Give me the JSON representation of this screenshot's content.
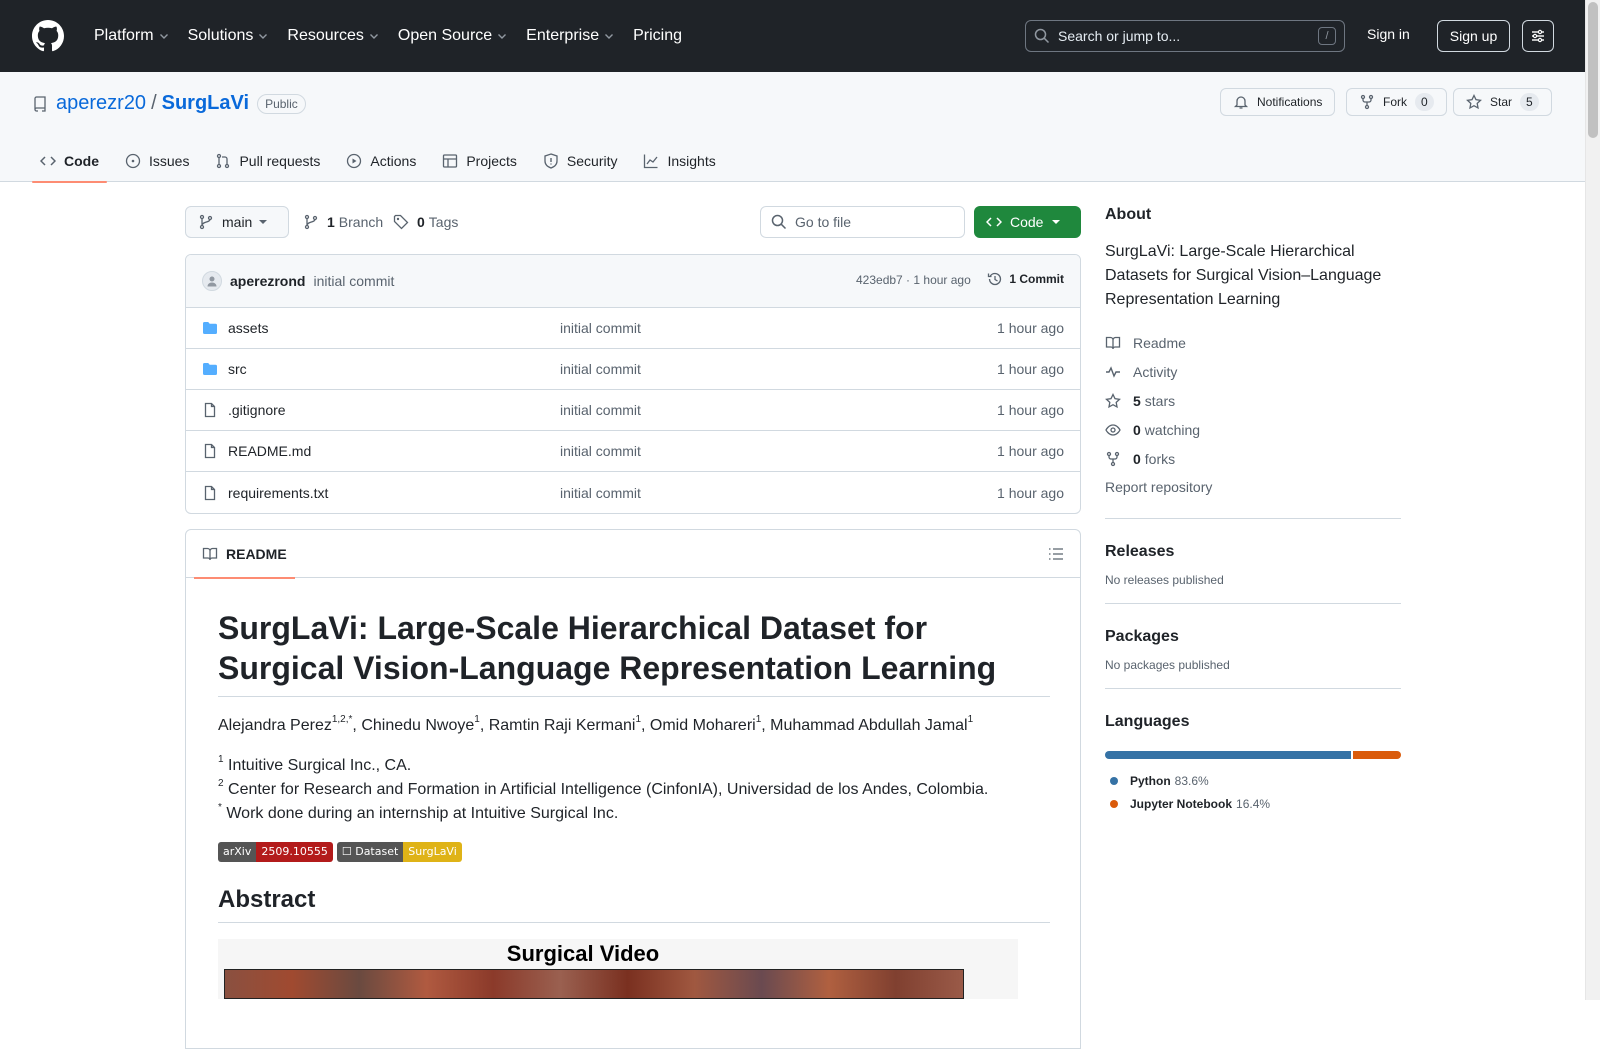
{
  "header": {
    "nav": [
      "Platform",
      "Solutions",
      "Resources",
      "Open Source",
      "Enterprise",
      "Pricing"
    ],
    "search_placeholder": "Search or jump to...",
    "search_key": "/",
    "signin": "Sign in",
    "signup": "Sign up"
  },
  "repo": {
    "owner": "aperezr20",
    "separator": "/",
    "name": "SurgLaVi",
    "visibility": "Public",
    "notifications": "Notifications",
    "fork_label": "Fork",
    "fork_count": "0",
    "star_label": "Star",
    "star_count": "5",
    "tabs": [
      "Code",
      "Issues",
      "Pull requests",
      "Actions",
      "Projects",
      "Security",
      "Insights"
    ]
  },
  "toolbar": {
    "branch": "main",
    "branch_count": "1",
    "branch_label": "Branch",
    "tag_count": "0",
    "tag_label": "Tags",
    "gofile_placeholder": "Go to file",
    "code_label": "Code"
  },
  "commit": {
    "author": "aperezrond",
    "message": "initial commit",
    "hash_time": "423edb7 · 1 hour ago",
    "count": "1 Commit"
  },
  "files": [
    {
      "name": "assets",
      "type": "folder",
      "message": "initial commit",
      "age": "1 hour ago"
    },
    {
      "name": "src",
      "type": "folder",
      "message": "initial commit",
      "age": "1 hour ago"
    },
    {
      "name": ".gitignore",
      "type": "file",
      "message": "initial commit",
      "age": "1 hour ago"
    },
    {
      "name": "README.md",
      "type": "file",
      "message": "initial commit",
      "age": "1 hour ago"
    },
    {
      "name": "requirements.txt",
      "type": "file",
      "message": "initial commit",
      "age": "1 hour ago"
    }
  ],
  "readme": {
    "tab": "README",
    "title": "SurgLaVi: Large-Scale Hierarchical Dataset for Surgical Vision-Language Representation Learning",
    "authors": [
      {
        "name": "Alejandra Perez",
        "sup": "1,2,*"
      },
      {
        "name": "Chinedu Nwoye",
        "sup": "1"
      },
      {
        "name": "Ramtin Raji Kermani",
        "sup": "1"
      },
      {
        "name": "Omid Mohareri",
        "sup": "1"
      },
      {
        "name": "Muhammad Abdullah Jamal",
        "sup": "1"
      }
    ],
    "affiliations": [
      {
        "sup": "1",
        "text": " Intuitive Surgical Inc., CA."
      },
      {
        "sup": "2",
        "text": " Center for Research and Formation in Artificial Intelligence (CinfonIA), Universidad de los Andes, Colombia."
      },
      {
        "sup": "*",
        "text": " Work done during an internship at Intuitive Surgical Inc."
      }
    ],
    "badges": [
      {
        "left": "arXiv",
        "right": "2509.10555",
        "color": "#b31b1b"
      },
      {
        "left": "☐ Dataset",
        "right": "SurgLaVi",
        "color": "#dfb317"
      }
    ],
    "abstract_heading": "Abstract",
    "figure_title": "Surgical Video"
  },
  "sidebar": {
    "about_heading": "About",
    "description": "SurgLaVi: Large-Scale Hierarchical Datasets for Surgical Vision–Language Representation Learning",
    "readme": "Readme",
    "activity": "Activity",
    "stars_count": "5",
    "stars_label": "stars",
    "watching_count": "0",
    "watching_label": "watching",
    "forks_count": "0",
    "forks_label": "forks",
    "report": "Report repository",
    "releases_heading": "Releases",
    "releases_sub": "No releases published",
    "packages_heading": "Packages",
    "packages_sub": "No packages published",
    "languages_heading": "Languages",
    "languages": [
      {
        "name": "Python",
        "percent": "83.6%",
        "value": 83.6,
        "color": "#3572A5"
      },
      {
        "name": "Jupyter Notebook",
        "percent": "16.4%",
        "value": 16.4,
        "color": "#DA5B0B"
      }
    ]
  }
}
